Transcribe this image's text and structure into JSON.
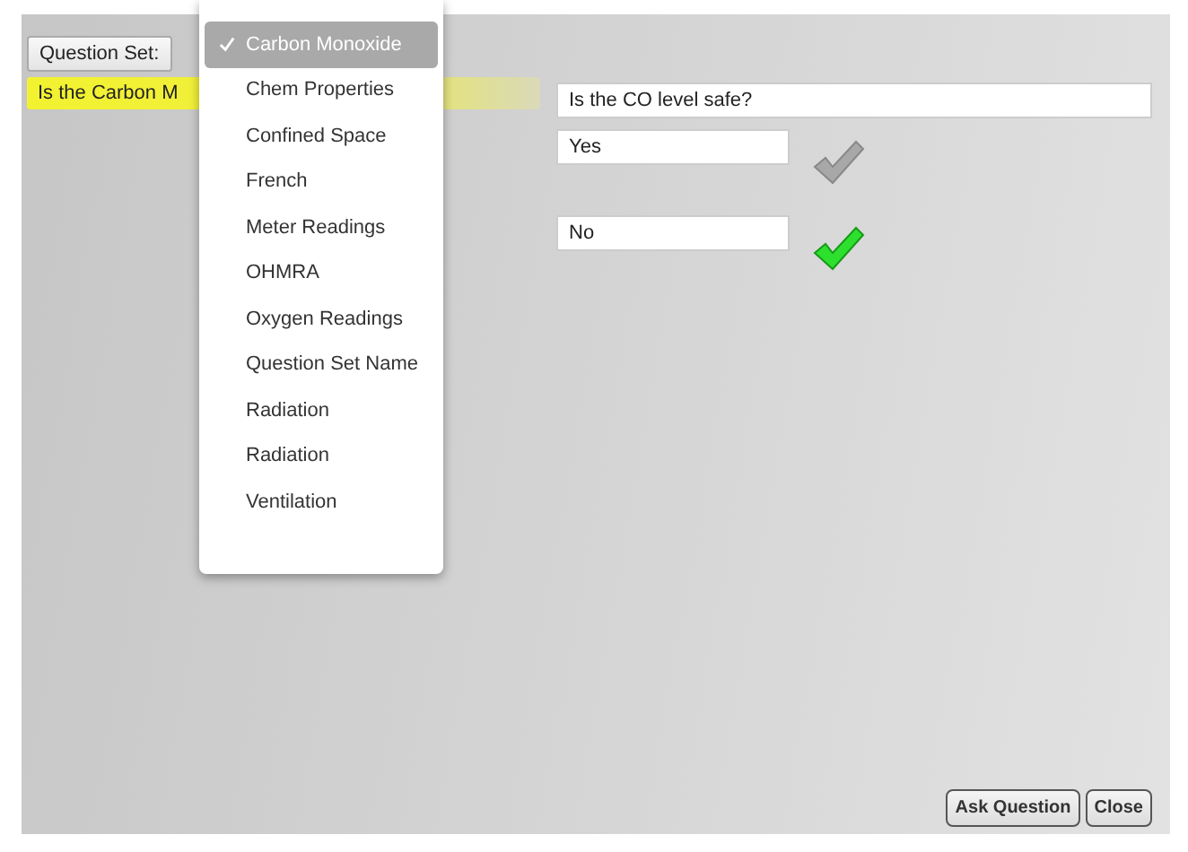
{
  "question_set_button": {
    "label": "Question Set:"
  },
  "question_row": {
    "text": "Is the Carbon M"
  },
  "question_set_menu": {
    "items": [
      {
        "label": "Carbon Monoxide",
        "selected": true
      },
      {
        "label": "Chem Properties",
        "selected": false
      },
      {
        "label": "Confined Space",
        "selected": false
      },
      {
        "label": "French",
        "selected": false
      },
      {
        "label": "Meter Readings",
        "selected": false
      },
      {
        "label": "OHMRA",
        "selected": false
      },
      {
        "label": "Oxygen Readings",
        "selected": false
      },
      {
        "label": "Question Set Name",
        "selected": false
      },
      {
        "label": "Radiation",
        "selected": false
      },
      {
        "label": "Radiation",
        "selected": false
      },
      {
        "label": "Ventilation",
        "selected": false
      }
    ]
  },
  "question_field": {
    "value": "Is the CO level safe?"
  },
  "answers": [
    {
      "value": "Yes",
      "correct": false
    },
    {
      "value": "No",
      "correct": true
    }
  ],
  "buttons": [
    {
      "label": "Ask Question"
    },
    {
      "label": "Close"
    }
  ]
}
